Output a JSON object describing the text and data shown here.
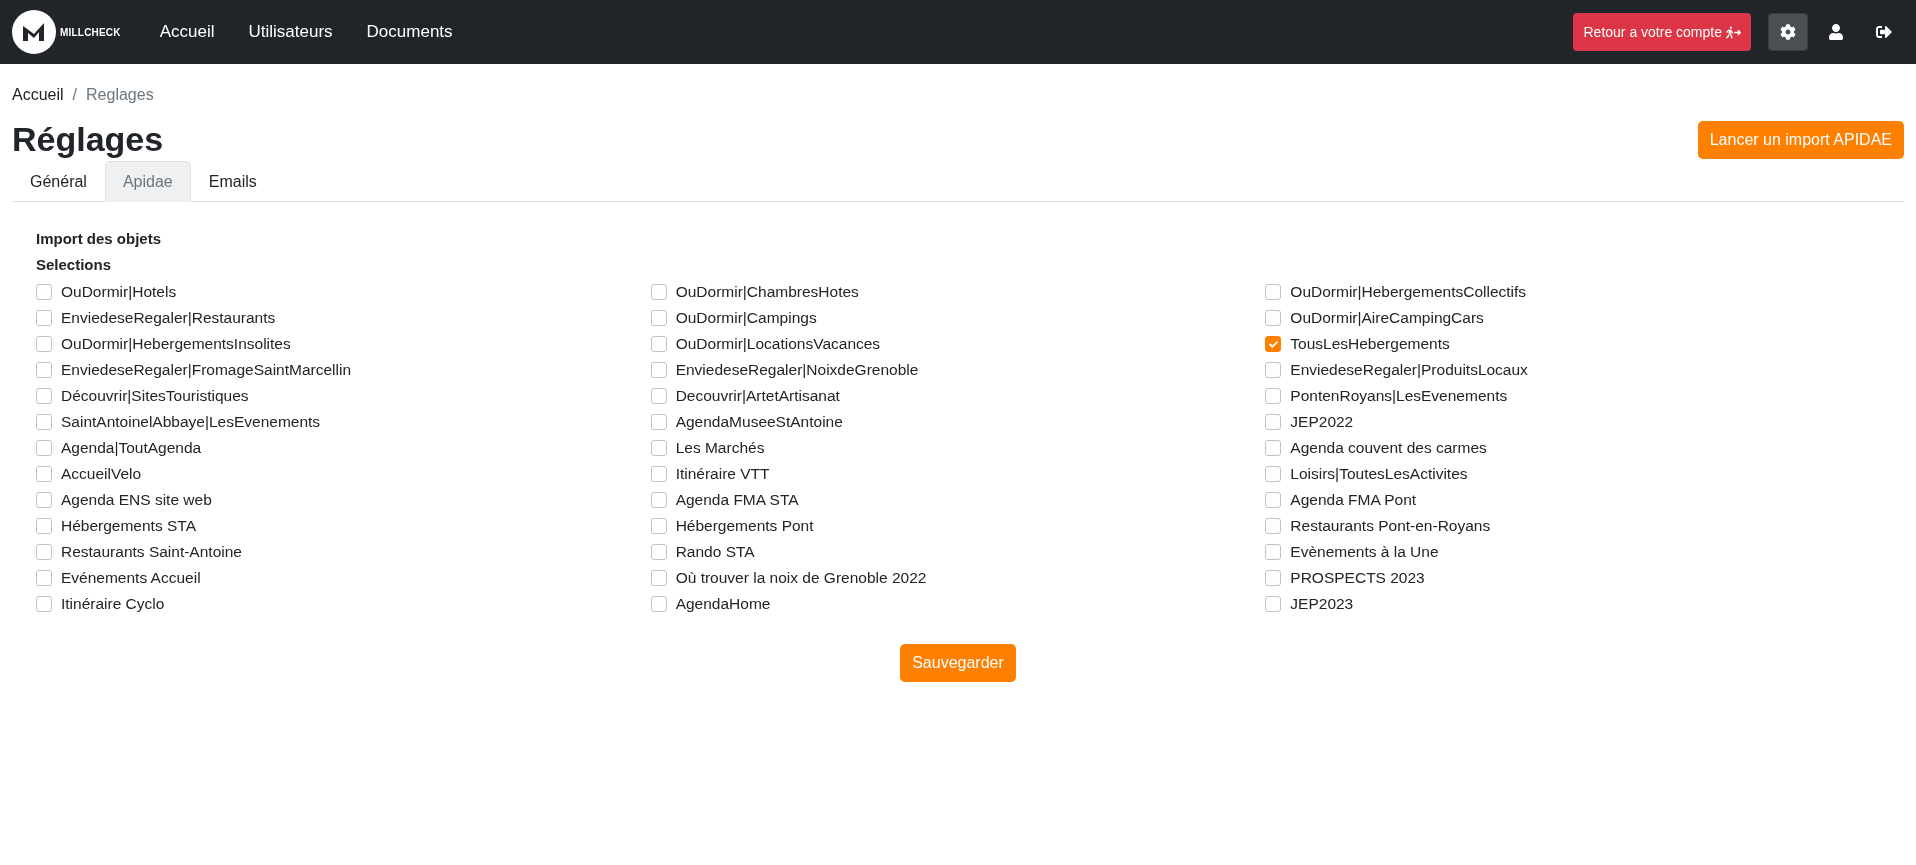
{
  "navbar": {
    "brand": "MILLCHECK",
    "links": [
      "Accueil",
      "Utilisateurs",
      "Documents"
    ],
    "return_button": "Retour a votre compte"
  },
  "breadcrumb": {
    "items": [
      "Accueil",
      "Reglages"
    ],
    "separator": "/"
  },
  "page": {
    "title": "Réglages",
    "import_button": "Lancer un import APIDAE"
  },
  "tabs": [
    {
      "label": "Général",
      "selected": false
    },
    {
      "label": "Apidae",
      "selected": true
    },
    {
      "label": "Emails",
      "selected": false
    }
  ],
  "form": {
    "heading": "Import des objets",
    "subheading": "Selections",
    "options": [
      {
        "label": "OuDormir|Hotels",
        "checked": false
      },
      {
        "label": "OuDormir|ChambresHotes",
        "checked": false
      },
      {
        "label": "OuDormir|HebergementsCollectifs",
        "checked": false
      },
      {
        "label": "EnviedeseRegaler|Restaurants",
        "checked": false
      },
      {
        "label": "OuDormir|Campings",
        "checked": false
      },
      {
        "label": "OuDormir|AireCampingCars",
        "checked": false
      },
      {
        "label": "OuDormir|HebergementsInsolites",
        "checked": false
      },
      {
        "label": "OuDormir|LocationsVacances",
        "checked": false
      },
      {
        "label": "TousLesHebergements",
        "checked": true
      },
      {
        "label": "EnviedeseRegaler|FromageSaintMarcellin",
        "checked": false
      },
      {
        "label": "EnviedeseRegaler|NoixdeGrenoble",
        "checked": false
      },
      {
        "label": "EnviedeseRegaler|ProduitsLocaux",
        "checked": false
      },
      {
        "label": "Découvrir|SitesTouristiques",
        "checked": false
      },
      {
        "label": "Decouvrir|ArtetArtisanat",
        "checked": false
      },
      {
        "label": "PontenRoyans|LesEvenements",
        "checked": false
      },
      {
        "label": "SaintAntoinelAbbaye|LesEvenements",
        "checked": false
      },
      {
        "label": "AgendaMuseeStAntoine",
        "checked": false
      },
      {
        "label": "JEP2022",
        "checked": false
      },
      {
        "label": "Agenda|ToutAgenda",
        "checked": false
      },
      {
        "label": "Les Marchés",
        "checked": false
      },
      {
        "label": "Agenda couvent des carmes",
        "checked": false
      },
      {
        "label": "AccueilVelo",
        "checked": false
      },
      {
        "label": "Itinéraire VTT",
        "checked": false
      },
      {
        "label": "Loisirs|ToutesLesActivites",
        "checked": false
      },
      {
        "label": "Agenda ENS site web",
        "checked": false
      },
      {
        "label": "Agenda FMA STA",
        "checked": false
      },
      {
        "label": "Agenda FMA Pont",
        "checked": false
      },
      {
        "label": "Hébergements STA",
        "checked": false
      },
      {
        "label": "Hébergements Pont",
        "checked": false
      },
      {
        "label": "Restaurants Pont-en-Royans",
        "checked": false
      },
      {
        "label": "Restaurants Saint-Antoine",
        "checked": false
      },
      {
        "label": "Rando STA",
        "checked": false
      },
      {
        "label": "Evènements à la Une",
        "checked": false
      },
      {
        "label": "Evénements Accueil",
        "checked": false
      },
      {
        "label": "Où trouver la noix de Grenoble 2022",
        "checked": false
      },
      {
        "label": "PROSPECTS 2023",
        "checked": false
      },
      {
        "label": "Itinéraire Cyclo",
        "checked": false
      },
      {
        "label": "AgendaHome",
        "checked": false
      },
      {
        "label": "JEP2023",
        "checked": false
      }
    ],
    "save_button": "Sauvegarder"
  }
}
